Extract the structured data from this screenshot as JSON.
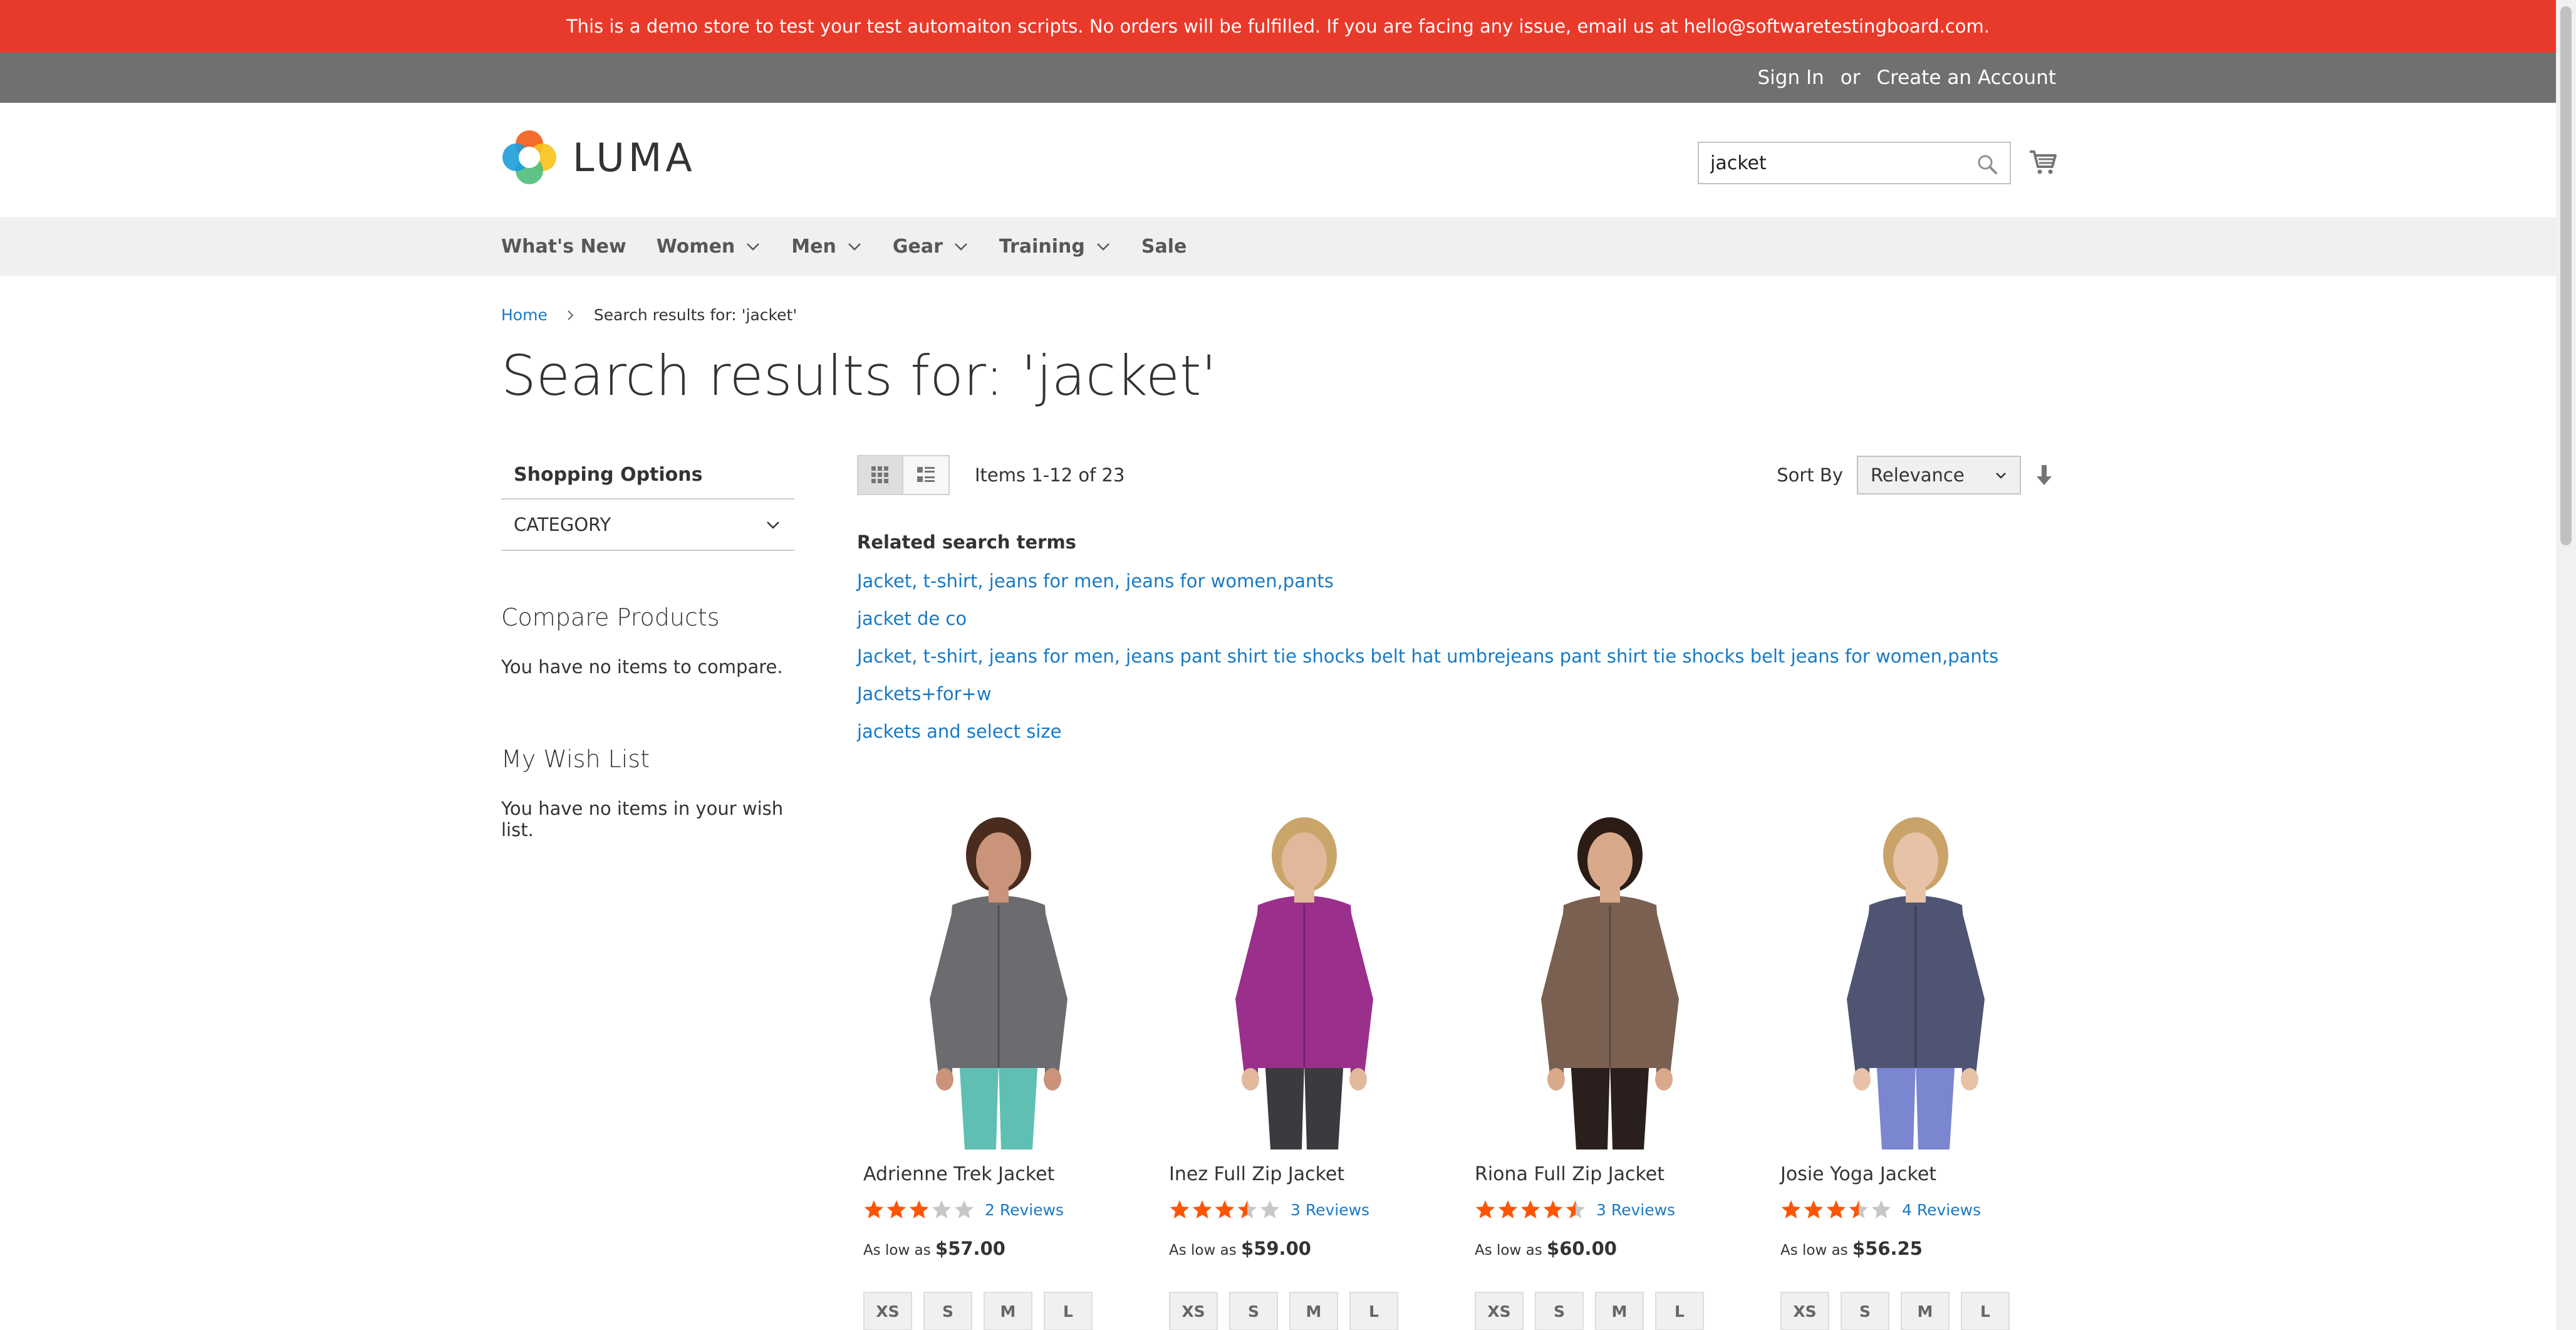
{
  "promo": "This is a demo store to test your test automaiton scripts. No orders will be fulfilled. If you are facing any issue, email us at hello@softwaretestingboard.com.",
  "account": {
    "sign_in": "Sign In",
    "or": "or",
    "create_account": "Create an Account"
  },
  "logo": {
    "text": "LUMA"
  },
  "search": {
    "value": "jacket"
  },
  "nav": {
    "items": [
      {
        "label": "What's New"
      },
      {
        "label": "Women"
      },
      {
        "label": "Men"
      },
      {
        "label": "Gear"
      },
      {
        "label": "Training"
      },
      {
        "label": "Sale"
      }
    ]
  },
  "breadcrumb": {
    "home": "Home",
    "current": "Search results for: 'jacket'"
  },
  "page_title": "Search results for: 'jacket'",
  "sidebar": {
    "shopping_options": "Shopping Options",
    "category": "CATEGORY",
    "compare_title": "Compare Products",
    "compare_empty": "You have no items to compare.",
    "wishlist_title": "My Wish List",
    "wishlist_empty": "You have no items in your wish list."
  },
  "toolbar": {
    "amount": "Items 1-12 of 23",
    "sort_label": "Sort By",
    "sort_value": "Relevance"
  },
  "related": {
    "title": "Related search terms",
    "terms": [
      "Jacket, t-shirt, jeans for men, jeans for women,pants",
      "jacket de co",
      "Jacket, t-shirt, jeans for men, jeans pant shirt tie shocks belt hat umbrejeans pant shirt tie shocks belt jeans for women,pants",
      "Jackets+for+w",
      "jackets and select size"
    ]
  },
  "products": [
    {
      "name": "Adrienne Trek Jacket",
      "rating": 3,
      "reviews": "2 Reviews",
      "price_label": "As low as",
      "price": "$57.00",
      "sizes": [
        "XS",
        "S",
        "M",
        "L"
      ],
      "colors": {
        "top": "#6c6b6f",
        "bottom": "#5fbfb3",
        "skin": "#c99479",
        "hair": "#4a2c1f"
      }
    },
    {
      "name": "Inez Full Zip Jacket",
      "rating": 3.5,
      "reviews": "3 Reviews",
      "price_label": "As low as",
      "price": "$59.00",
      "sizes": [
        "XS",
        "S",
        "M",
        "L"
      ],
      "colors": {
        "top": "#9b2f8c",
        "bottom": "#3b3b3f",
        "skin": "#e2b89c",
        "hair": "#c9a56a"
      }
    },
    {
      "name": "Riona Full Zip Jacket",
      "rating": 4.5,
      "reviews": "3 Reviews",
      "price_label": "As low as",
      "price": "$60.00",
      "sizes": [
        "XS",
        "S",
        "M",
        "L"
      ],
      "colors": {
        "top": "#7a6051",
        "bottom": "#2a1f1c",
        "skin": "#d9a98c",
        "hair": "#2b1c15"
      }
    },
    {
      "name": "Josie Yoga Jacket",
      "rating": 3.5,
      "reviews": "4 Reviews",
      "price_label": "As low as",
      "price": "$56.25",
      "sizes": [
        "XS",
        "S",
        "M",
        "L"
      ],
      "colors": {
        "top": "#4e5472",
        "bottom": "#7a86cf",
        "skin": "#e7c2a6",
        "hair": "#c9a36a"
      }
    }
  ]
}
